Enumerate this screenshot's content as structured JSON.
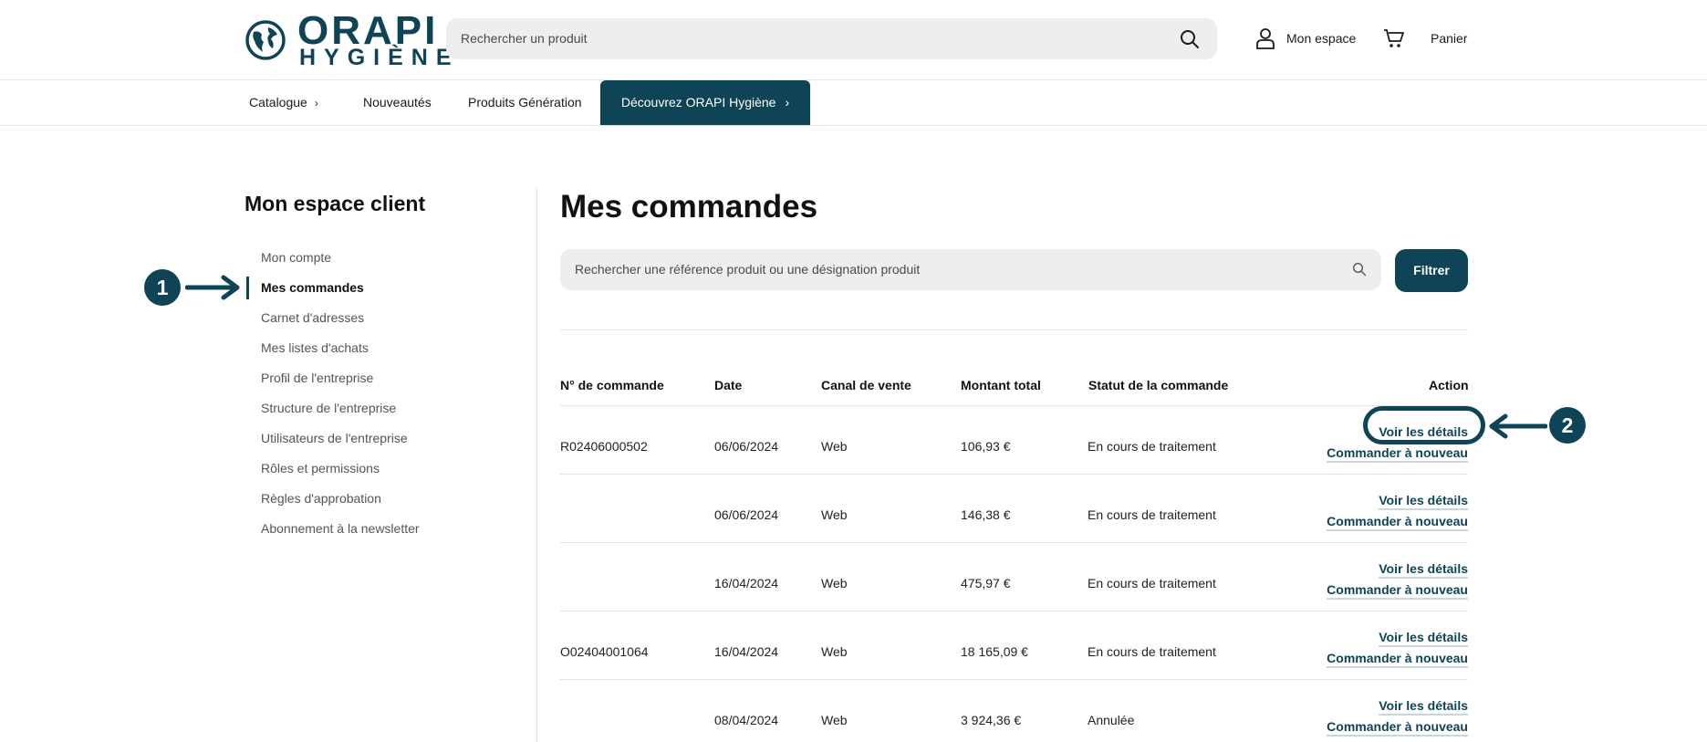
{
  "header": {
    "logo_top": "ORAPI",
    "logo_bottom": "HYGIÈNE",
    "search_placeholder": "Rechercher un produit",
    "account_label": "Mon espace",
    "cart_label": "Panier"
  },
  "nav": {
    "items": [
      {
        "label": "Catalogue",
        "chevron": "›"
      },
      {
        "label": "Nouveautés"
      },
      {
        "label": "Produits Génération"
      }
    ],
    "cta": {
      "label": "Découvrez ORAPI Hygiène",
      "chevron": "›"
    }
  },
  "sidebar": {
    "title": "Mon espace client",
    "items": [
      {
        "label": "Mon compte"
      },
      {
        "label": "Mes commandes",
        "active": true
      },
      {
        "label": "Carnet d'adresses"
      },
      {
        "label": "Mes listes d'achats"
      },
      {
        "label": "Profil de l'entreprise"
      },
      {
        "label": "Structure de l'entreprise"
      },
      {
        "label": "Utilisateurs de l'entreprise"
      },
      {
        "label": "Rôles et permissions"
      },
      {
        "label": "Règles d'approbation"
      },
      {
        "label": "Abonnement à la newsletter"
      }
    ]
  },
  "main": {
    "title": "Mes commandes",
    "search_placeholder": "Rechercher une référence produit ou une désignation produit",
    "filter_label": "Filtrer",
    "columns": [
      "N° de commande",
      "Date",
      "Canal de vente",
      "Montant total",
      "Statut de la commande",
      "Action"
    ],
    "action_details": "Voir les détails",
    "action_reorder": "Commander à nouveau",
    "orders": [
      {
        "number": "R02406000502",
        "date": "06/06/2024",
        "channel": "Web",
        "total": "106,93 €",
        "status": "En cours de traitement"
      },
      {
        "number": "",
        "date": "06/06/2024",
        "channel": "Web",
        "total": "146,38 €",
        "status": "En cours de traitement"
      },
      {
        "number": "",
        "date": "16/04/2024",
        "channel": "Web",
        "total": "475,97 €",
        "status": "En cours de traitement"
      },
      {
        "number": "O02404001064",
        "date": "16/04/2024",
        "channel": "Web",
        "total": "18 165,09 €",
        "status": "En cours de traitement"
      },
      {
        "number": "",
        "date": "08/04/2024",
        "channel": "Web",
        "total": "3 924,36 €",
        "status": "Annulée"
      }
    ]
  },
  "annotations": {
    "badge1": "1",
    "badge2": "2"
  },
  "colors": {
    "brand": "#0e4456",
    "search_bg": "#eeeeee"
  }
}
